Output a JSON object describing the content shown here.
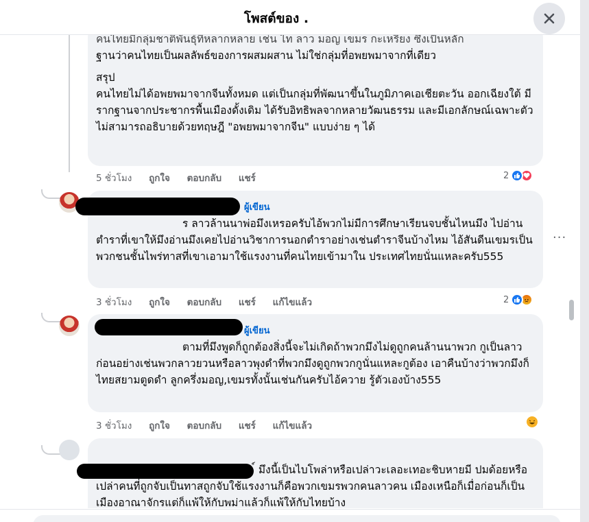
{
  "header": {
    "title": "โพสต์ของ ."
  },
  "comments": [
    {
      "paragraphs": [
        "คนไทยมีกลุ่มชาติพันธุ์ที่หลากหลาย เช่น ไท ลาว มอญ เขมร กะเหรี่ยง ซึ่งเป็นหลัก",
        "ฐานว่าคนไทยเป็นผลลัพธ์ของการผสมผสาน ไม่ใช่กลุ่มที่อพยพมาจากที่เดียว",
        "สรุป",
        "คนไทยไม่ได้อพยพมาจากจีนทั้งหมด แต่เป็นกลุ่มที่พัฒนาขึ้นในภูมิภาคเอเชียตะวัน ออกเฉียงใต้ มีรากฐานจากประชากรพื้นเมืองดั้งเดิม ได้รับอิทธิพลจากหลายวัฒนธรรม และมีเอกลักษณ์เฉพาะตัว ไม่สามารถอธิบายด้วยทฤษฎี \"อพยพมาจากจีน\" แบบง่าย ๆ ได้"
      ],
      "time": "5 ชั่วโมง",
      "like": "ถูกใจ",
      "reply": "ตอบกลับ",
      "share": "แชร์",
      "reaction_count": "2"
    },
    {
      "badge": "ผู้เขียน",
      "text": "ร ลาวล้านนาพ่อมึงเหรอครับไอ้พวกไม่มีการศึกษาเรียนจบชั้นไหนมึง ไปอ่านตำราที่เขาให้มึงอ่านมึงเคยไปอ่านวิชาการนอกตำราอย่างเช่นตำราจีนบ้างไหม ไอ้สันดีนเขมรเป็นพวกชนชั้นไพร่ทาสที่เขาเอามาใช้แรงงานที่คนไทยเข้ามาใน ประเทศไทยนั่นแหละครับ555",
      "time": "3 ชั่วโมง",
      "like": "ถูกใจ",
      "reply": "ตอบกลับ",
      "share": "แชร์",
      "edited": "แก้ไขแล้ว",
      "reaction_count": "2"
    },
    {
      "badge": "ผู้เขียน",
      "text": "ตามที่มึงพูดก็ถูกต้องสิ่งนี้จะไม่เกิดถ้าพวกมึงไม่ดูถูกคนล้านนาพวก กูเป็นลาวก่อนอย่างเช่นพวกลาวยวนหรือลาวพุงดำที่พวกมึงดูถูกพวกกูนั่นแหละกูต้อง เอาคืนบ้างว่าพวกมึงก็ไทยสยามตูดดำ ลูกครึ่งมอญ,เขมรทั้งนั้นเช่นกันครับไอ้ควาย รู้ตัวเองบ้าง555",
      "time": "3 ชั่วโมง",
      "like": "ถูกใจ",
      "reply": "ตอบกลับ",
      "share": "แชร์",
      "edited": "แก้ไขแล้ว"
    },
    {
      "text": "์ มึงนี้เป็นไบโพล่าหรือเปล่าวะเลอะเทอะชิบหายมี ปมด้อยหรือเปล่าคนที่ถูกจับเป็นทาสถูกจับใช้แรงงานก็คือพวกเขมรพวกคนลาวคน เมืองเหนือก็เมื่อก่อนก็เป็นเมืองอาณาจักรแต่ก็แพ้ให้กับพม่าแล้วก็แพ้ให้กับไทยบ้าง"
    }
  ],
  "colors": {
    "accent": "#1877f2",
    "bubble": "#f0f2f5",
    "meta": "#65676b",
    "badge": "#0064d1"
  }
}
